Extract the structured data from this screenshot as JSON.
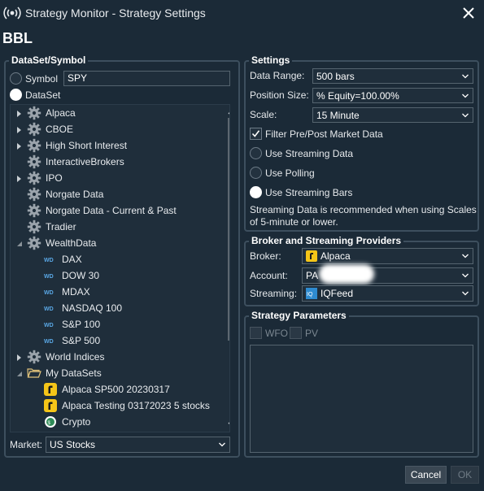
{
  "window": {
    "title": "Strategy Monitor - Strategy Settings",
    "close_icon": "close-icon"
  },
  "strategy_name": "BBL",
  "dataset_symbol": {
    "group_title": "DataSet/Symbol",
    "symbol_label": "Symbol",
    "symbol_value": "SPY",
    "dataset_label": "DataSet",
    "selected_option": "DataSet",
    "tree": [
      {
        "label": "Alpaca",
        "icon": "gear-icon",
        "expander": "collapsed"
      },
      {
        "label": "CBOE",
        "icon": "gear-icon",
        "expander": "collapsed"
      },
      {
        "label": "High Short Interest",
        "icon": "gear-icon",
        "expander": "collapsed"
      },
      {
        "label": "InteractiveBrokers",
        "icon": "gear-icon",
        "expander": "none"
      },
      {
        "label": "IPO",
        "icon": "gear-icon",
        "expander": "collapsed"
      },
      {
        "label": "Norgate Data",
        "icon": "gear-icon",
        "expander": "none"
      },
      {
        "label": "Norgate Data - Current & Past",
        "icon": "gear-icon",
        "expander": "none"
      },
      {
        "label": "Tradier",
        "icon": "gear-icon",
        "expander": "none"
      },
      {
        "label": "WealthData",
        "icon": "gear-icon",
        "expander": "expanded"
      },
      {
        "label": "DAX",
        "icon": "wealthdata-icon",
        "expander": "none"
      },
      {
        "label": "DOW 30",
        "icon": "wealthdata-icon",
        "expander": "none"
      },
      {
        "label": "MDAX",
        "icon": "wealthdata-icon",
        "expander": "none"
      },
      {
        "label": "NASDAQ 100",
        "icon": "wealthdata-icon",
        "expander": "none"
      },
      {
        "label": "S&P 100",
        "icon": "wealthdata-icon",
        "expander": "none"
      },
      {
        "label": "S&P 500",
        "icon": "wealthdata-icon",
        "expander": "none"
      },
      {
        "label": "World Indices",
        "icon": "gear-icon",
        "expander": "collapsed"
      },
      {
        "label": "My DataSets",
        "icon": "folder-open-icon",
        "expander": "expanded"
      },
      {
        "label": "Alpaca SP500 20230317",
        "icon": "alpaca-icon",
        "expander": "none"
      },
      {
        "label": "Alpaca Testing 03172023 5 stocks",
        "icon": "alpaca-icon",
        "expander": "none"
      },
      {
        "label": "Crypto",
        "icon": "crypto-icon",
        "expander": "none"
      }
    ],
    "market_label": "Market:",
    "market_value": "US Stocks"
  },
  "settings": {
    "group_title": "Settings",
    "data_range_label": "Data Range:",
    "data_range_value": "500 bars",
    "position_size_label": "Position Size:",
    "position_size_value": "% Equity=100.00%",
    "scale_label": "Scale:",
    "scale_value": "15 Minute",
    "filter_label": "Filter Pre/Post Market Data",
    "filter_checked": true,
    "streaming_data_label": "Use Streaming Data",
    "polling_label": "Use Polling",
    "streaming_bars_label": "Use Streaming Bars",
    "selected_mode": "Use Streaming Bars",
    "note_line1": "Streaming Data is recommended when using Scales",
    "note_line2": "of 5-minute or lower."
  },
  "broker": {
    "group_title": "Broker and Streaming Providers",
    "broker_label": "Broker:",
    "broker_value": "Alpaca",
    "account_label": "Account:",
    "account_value": "PA",
    "streaming_label": "Streaming:",
    "streaming_value": "IQFeed"
  },
  "strategy_parameters": {
    "group_title": "Strategy Parameters",
    "wfo_label": "WFO",
    "pv_label": "PV"
  },
  "buttons": {
    "cancel": "Cancel",
    "ok": "OK"
  },
  "colors": {
    "background": "#1b2a37",
    "border": "#3d4f5e",
    "field": "#1f2e3b",
    "alpaca_yellow": "#f5c518",
    "iqfeed_blue": "#2e8bd0"
  }
}
